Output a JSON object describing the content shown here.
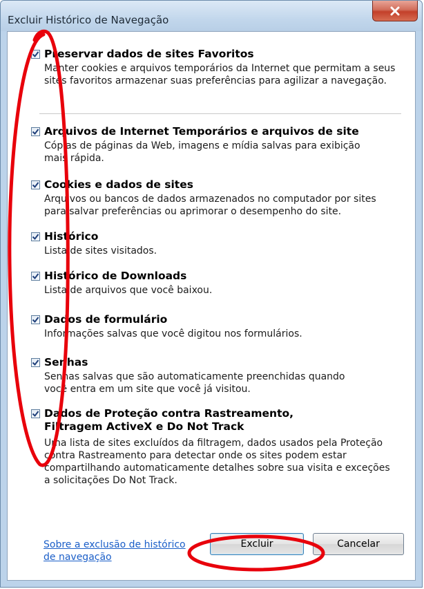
{
  "window": {
    "title": "Excluir Histórico de Navegação",
    "close_glyph": "X"
  },
  "options": [
    {
      "label": "Preservar dados de sites Favoritos",
      "checked": true,
      "desc": [
        "Manter cookies e arquivos temporários da Internet que permitam a seus",
        "sites favoritos armazenar suas preferências para agilizar a navegação."
      ]
    },
    {
      "label": "Arquivos de Internet Temporários e arquivos de site",
      "checked": true,
      "desc": [
        "Cópias de páginas da Web, imagens e mídia salvas para exibição",
        "mais rápida."
      ]
    },
    {
      "label": "Cookies e dados de sites",
      "checked": true,
      "desc": [
        "Arquivos ou bancos de dados armazenados no computador por sites",
        "para salvar preferências ou aprimorar o desempenho do site."
      ]
    },
    {
      "label": "Histórico",
      "checked": true,
      "desc": [
        "Lista de sites visitados."
      ]
    },
    {
      "label": "Histórico de Downloads",
      "checked": true,
      "desc": [
        "Lista de arquivos que você baixou."
      ]
    },
    {
      "label": "Dados de formulário",
      "checked": true,
      "desc": [
        "Informações salvas que você digitou nos formulários."
      ]
    },
    {
      "label": "Senhas",
      "checked": true,
      "desc": [
        "Senhas salvas que são automaticamente preenchidas quando",
        "você entra em um site que você já visitou."
      ]
    },
    {
      "label": "Dados de Proteção contra Rastreamento,",
      "label2": "Filtragem ActiveX e Do Not Track",
      "checked": true,
      "desc": [
        "Uma lista de sites excluídos da filtragem, dados usados pela Proteção",
        "contra Rastreamento para detectar onde os sites podem estar",
        "compartilhando automaticamente detalhes sobre sua visita e exceções",
        "a solicitações Do Not Track."
      ]
    }
  ],
  "footer": {
    "help_link": [
      "Sobre a exclusão de histórico",
      "de navegação"
    ],
    "delete_button": "Excluir",
    "cancel_button": "Cancelar"
  },
  "colors": {
    "annotation": "#e8000b",
    "link": "#1a5ec8"
  }
}
